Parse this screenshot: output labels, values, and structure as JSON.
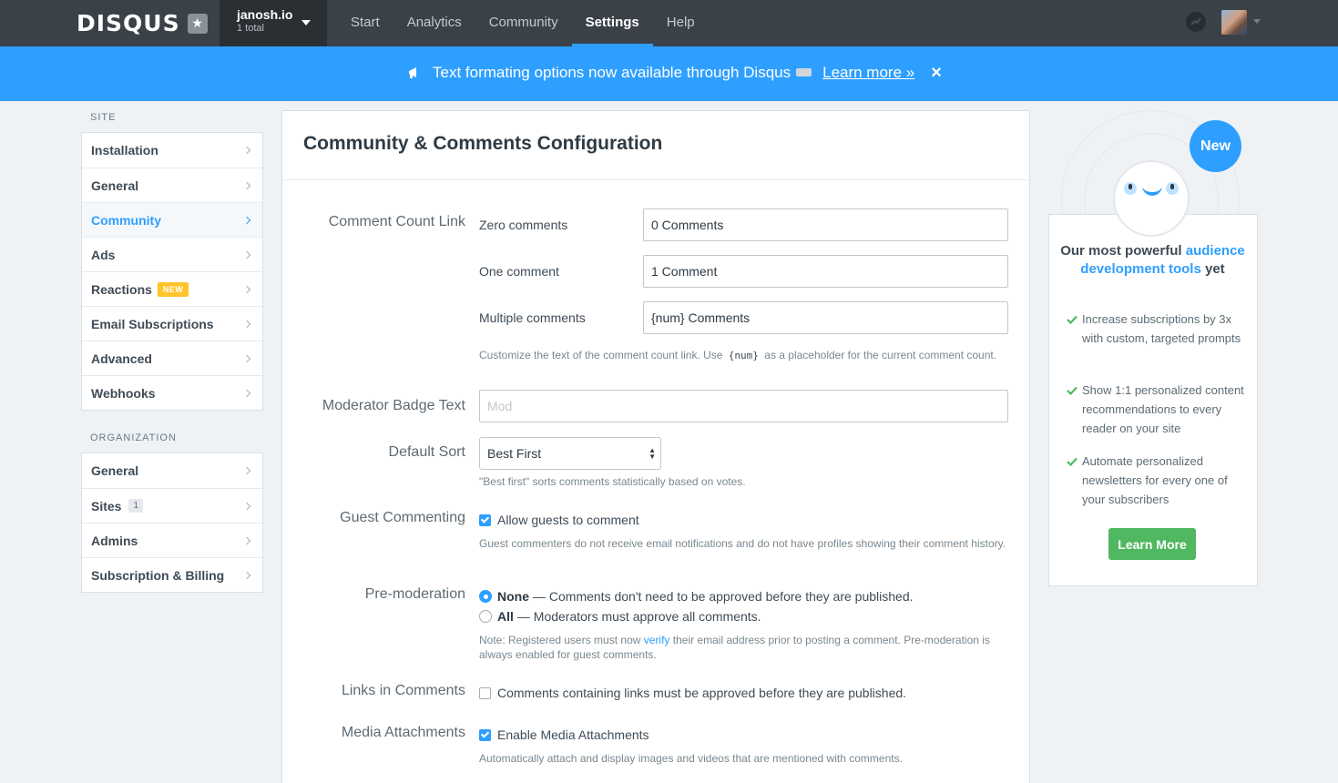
{
  "header": {
    "logo": "DISQUS",
    "site_name": "janosh.io",
    "site_count": "1 total",
    "nav": [
      {
        "label": "Start"
      },
      {
        "label": "Analytics"
      },
      {
        "label": "Community"
      },
      {
        "label": "Settings",
        "active": true
      },
      {
        "label": "Help"
      }
    ]
  },
  "banner": {
    "text": "Text formating options now available through Disqus",
    "link": "Learn more »",
    "close": "×",
    "background": "#2e9fff"
  },
  "sidebar": {
    "site_heading": "SITE",
    "site_items": [
      {
        "label": "Installation"
      },
      {
        "label": "General"
      },
      {
        "label": "Community",
        "active": true
      },
      {
        "label": "Ads"
      },
      {
        "label": "Reactions",
        "badge": "NEW"
      },
      {
        "label": "Email Subscriptions"
      },
      {
        "label": "Advanced"
      },
      {
        "label": "Webhooks"
      }
    ],
    "org_heading": "ORGANIZATION",
    "org_items": [
      {
        "label": "General"
      },
      {
        "label": "Sites",
        "badge": "1"
      },
      {
        "label": "Admins"
      },
      {
        "label": "Subscription & Billing"
      }
    ]
  },
  "main": {
    "title": "Community & Comments Configuration",
    "comment_count": {
      "label": "Comment Count Link",
      "zero_label": "Zero comments",
      "zero_value": "0 Comments",
      "one_label": "One comment",
      "one_value": "1 Comment",
      "multiple_label": "Multiple comments",
      "multiple_value": "{num} Comments",
      "help_before": "Customize the text of the comment count link. Use",
      "help_code": "{num}",
      "help_after": "as a placeholder for the current comment count."
    },
    "moderator_badge": {
      "label": "Moderator Badge Text",
      "value": "",
      "placeholder": "Mod"
    },
    "default_sort": {
      "label": "Default Sort",
      "selected": "Best First",
      "help": "\"Best first\" sorts comments statistically based on votes."
    },
    "guest_commenting": {
      "label": "Guest Commenting",
      "option": "Allow guests to comment",
      "checked": true,
      "help": "Guest commenters do not receive email notifications and do not have profiles showing their comment history."
    },
    "premoderation": {
      "label": "Pre-moderation",
      "options": [
        {
          "strong": "None",
          "text": "— Comments don't need to be approved before they are published.",
          "checked": true
        },
        {
          "strong": "All",
          "text": "— Moderators must approve all comments.",
          "checked": false
        }
      ],
      "note_before": "Note: Registered users must now",
      "note_link": "verify",
      "note_after": "their email address prior to posting a comment. Pre-moderation is always enabled for guest comments."
    },
    "links_in_comments": {
      "label": "Links in Comments",
      "option": "Comments containing links must be approved before they are published.",
      "checked": false
    },
    "media_attachments": {
      "label": "Media Attachments",
      "option": "Enable Media Attachments",
      "checked": true,
      "help": "Automatically attach and display images and videos that are mentioned with comments."
    }
  },
  "promo": {
    "bubble": "New",
    "title_pre": "Our most powerful",
    "title_highlight": "audience development tools",
    "title_post": "yet",
    "items": [
      "Increase subscriptions by 3x with custom, targeted prompts",
      "Show 1:1 personalized content recommendations to every reader on your site",
      "Automate personalized newsletters for every one of your subscribers"
    ],
    "button": "Learn More",
    "button_color": "#50b860"
  }
}
